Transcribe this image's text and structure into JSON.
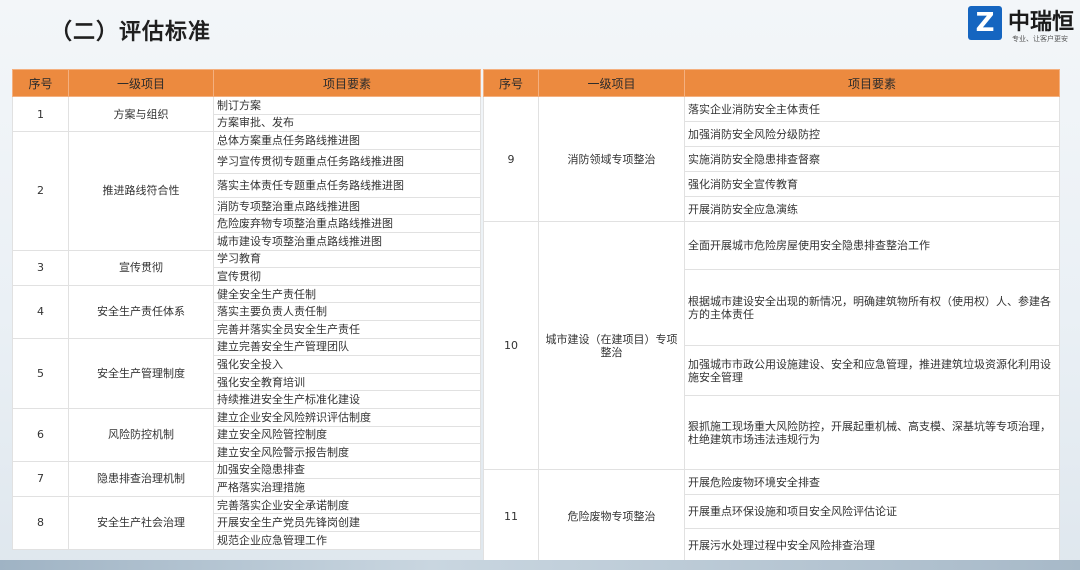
{
  "page": {
    "title": "（二）评估标准"
  },
  "logo": {
    "mark": "Z",
    "name": "中瑞恒",
    "slogan": "专业、让客户更安"
  },
  "left_table": {
    "headers": [
      "序号",
      "一级项目",
      "项目要素"
    ],
    "groups": [
      {
        "no": "1",
        "item": "方案与组织",
        "elements": [
          "制订方案",
          "方案审批、发布"
        ]
      },
      {
        "no": "2",
        "item": "推进路线符合性",
        "elements": [
          "总体方案重点任务路线推进图",
          "学习宣传贯彻专题重点任务路线推进图",
          "落实主体责任专题重点任务路线推进图",
          "消防专项整治重点路线推进图",
          "危险废弃物专项整治重点路线推进图",
          "城市建设专项整治重点路线推进图"
        ]
      },
      {
        "no": "3",
        "item": "宣传贯彻",
        "elements": [
          "学习教育",
          "宣传贯彻"
        ]
      },
      {
        "no": "4",
        "item": "安全生产责任体系",
        "elements": [
          "健全安全生产责任制",
          "落实主要负责人责任制",
          "完善并落实全员安全生产责任"
        ]
      },
      {
        "no": "5",
        "item": "安全生产管理制度",
        "elements": [
          "建立完善安全生产管理团队",
          "强化安全投入",
          "强化安全教育培训",
          "持续推进安全生产标准化建设"
        ]
      },
      {
        "no": "6",
        "item": "风险防控机制",
        "elements": [
          "建立企业安全风险辨识评估制度",
          "建立安全风险管控制度",
          "建立安全风险警示报告制度"
        ]
      },
      {
        "no": "7",
        "item": "隐患排查治理机制",
        "elements": [
          "加强安全隐患排查",
          "严格落实治理措施"
        ]
      },
      {
        "no": "8",
        "item": "安全生产社会治理",
        "elements": [
          "完善落实企业安全承诺制度",
          "开展安全生产党员先锋岗创建",
          "规范企业应急管理工作"
        ]
      }
    ]
  },
  "right_table": {
    "headers": [
      "序号",
      "一级项目",
      "项目要素"
    ],
    "groups": [
      {
        "no": "9",
        "item": "消防领域专项整治",
        "elements": [
          "落实企业消防安全主体责任",
          "加强消防安全风险分级防控",
          "实施消防安全隐患排查督察",
          "强化消防安全宣传教育",
          "开展消防安全应急演练"
        ]
      },
      {
        "no": "10",
        "item": "城市建设（在建项目）专项整治",
        "elements": [
          "全面开展城市危险房屋使用安全隐患排查整治工作",
          "根据城市建设安全出现的新情况，明确建筑物所有权（使用权）人、参建各方的主体责任",
          "加强城市市政公用设施建设、安全和应急管理，推进建筑垃圾资源化利用设施安全管理",
          "狠抓施工现场重大风险防控，开展起重机械、高支模、深基坑等专项治理，杜绝建筑市场违法违规行为"
        ]
      },
      {
        "no": "11",
        "item": "危险废物专项整治",
        "elements": [
          "开展危险废物环境安全排查",
          "开展重点环保设施和项目安全风险评估论证",
          "开展污水处理过程中安全风险排查治理"
        ]
      }
    ]
  }
}
